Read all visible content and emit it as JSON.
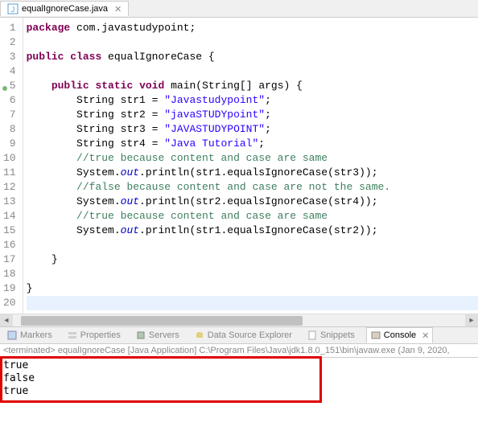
{
  "tab": {
    "filename": "equalIgnoreCase.java"
  },
  "gutter": [
    "1",
    "2",
    "3",
    "4",
    "5",
    "6",
    "7",
    "8",
    "9",
    "10",
    "11",
    "12",
    "13",
    "14",
    "15",
    "16",
    "17",
    "18",
    "19",
    "20"
  ],
  "code": {
    "l1": {
      "kw1": "package",
      "rest": " com.javastudypoint;"
    },
    "l3": {
      "kw1": "public",
      "kw2": "class",
      "name": " equalIgnoreCase {"
    },
    "l5": {
      "kw1": "public",
      "kw2": "static",
      "kw3": "void",
      "rest": " main(String[] args) {",
      "sp": "    "
    },
    "l6": {
      "indent": "        ",
      "t1": "String str1 = ",
      "str": "\"Javastudypoint\"",
      "t2": ";"
    },
    "l7": {
      "indent": "        ",
      "t1": "String str2 = ",
      "str": "\"javaSTUDYpoint\"",
      "t2": ";"
    },
    "l8": {
      "indent": "        ",
      "t1": "String str3 = ",
      "str": "\"JAVASTUDYPOINT\"",
      "t2": ";"
    },
    "l9": {
      "indent": "        ",
      "t1": "String str4 = ",
      "str": "\"Java Tutorial\"",
      "t2": ";"
    },
    "l10": {
      "indent": "        ",
      "cmt": "//true because content and case are same"
    },
    "l11": {
      "indent": "        ",
      "t1": "System.",
      "fld": "out",
      "t2": ".println(str1.equalsIgnoreCase(str3));"
    },
    "l12": {
      "indent": "        ",
      "cmt": "//false because content and case are not the same."
    },
    "l13": {
      "indent": "        ",
      "t1": "System.",
      "fld": "out",
      "t2": ".println(str2.equalsIgnoreCase(str4));"
    },
    "l14": {
      "indent": "        ",
      "cmt": "//true because content and case are same"
    },
    "l15": {
      "indent": "        ",
      "t1": "System.",
      "fld": "out",
      "t2": ".println(str1.equalsIgnoreCase(str2));"
    },
    "l17": {
      "indent": "    ",
      "brace": "}"
    },
    "l19": {
      "brace": "}"
    }
  },
  "views": {
    "markers": "Markers",
    "properties": "Properties",
    "servers": "Servers",
    "dse": "Data Source Explorer",
    "snippets": "Snippets",
    "console": "Console"
  },
  "status": "<terminated> equalIgnoreCase [Java Application] C:\\Program Files\\Java\\jdk1.8.0_151\\bin\\javaw.exe (Jan 9, 2020,",
  "output": {
    "l1": "true",
    "l2": "false",
    "l3": "true"
  }
}
